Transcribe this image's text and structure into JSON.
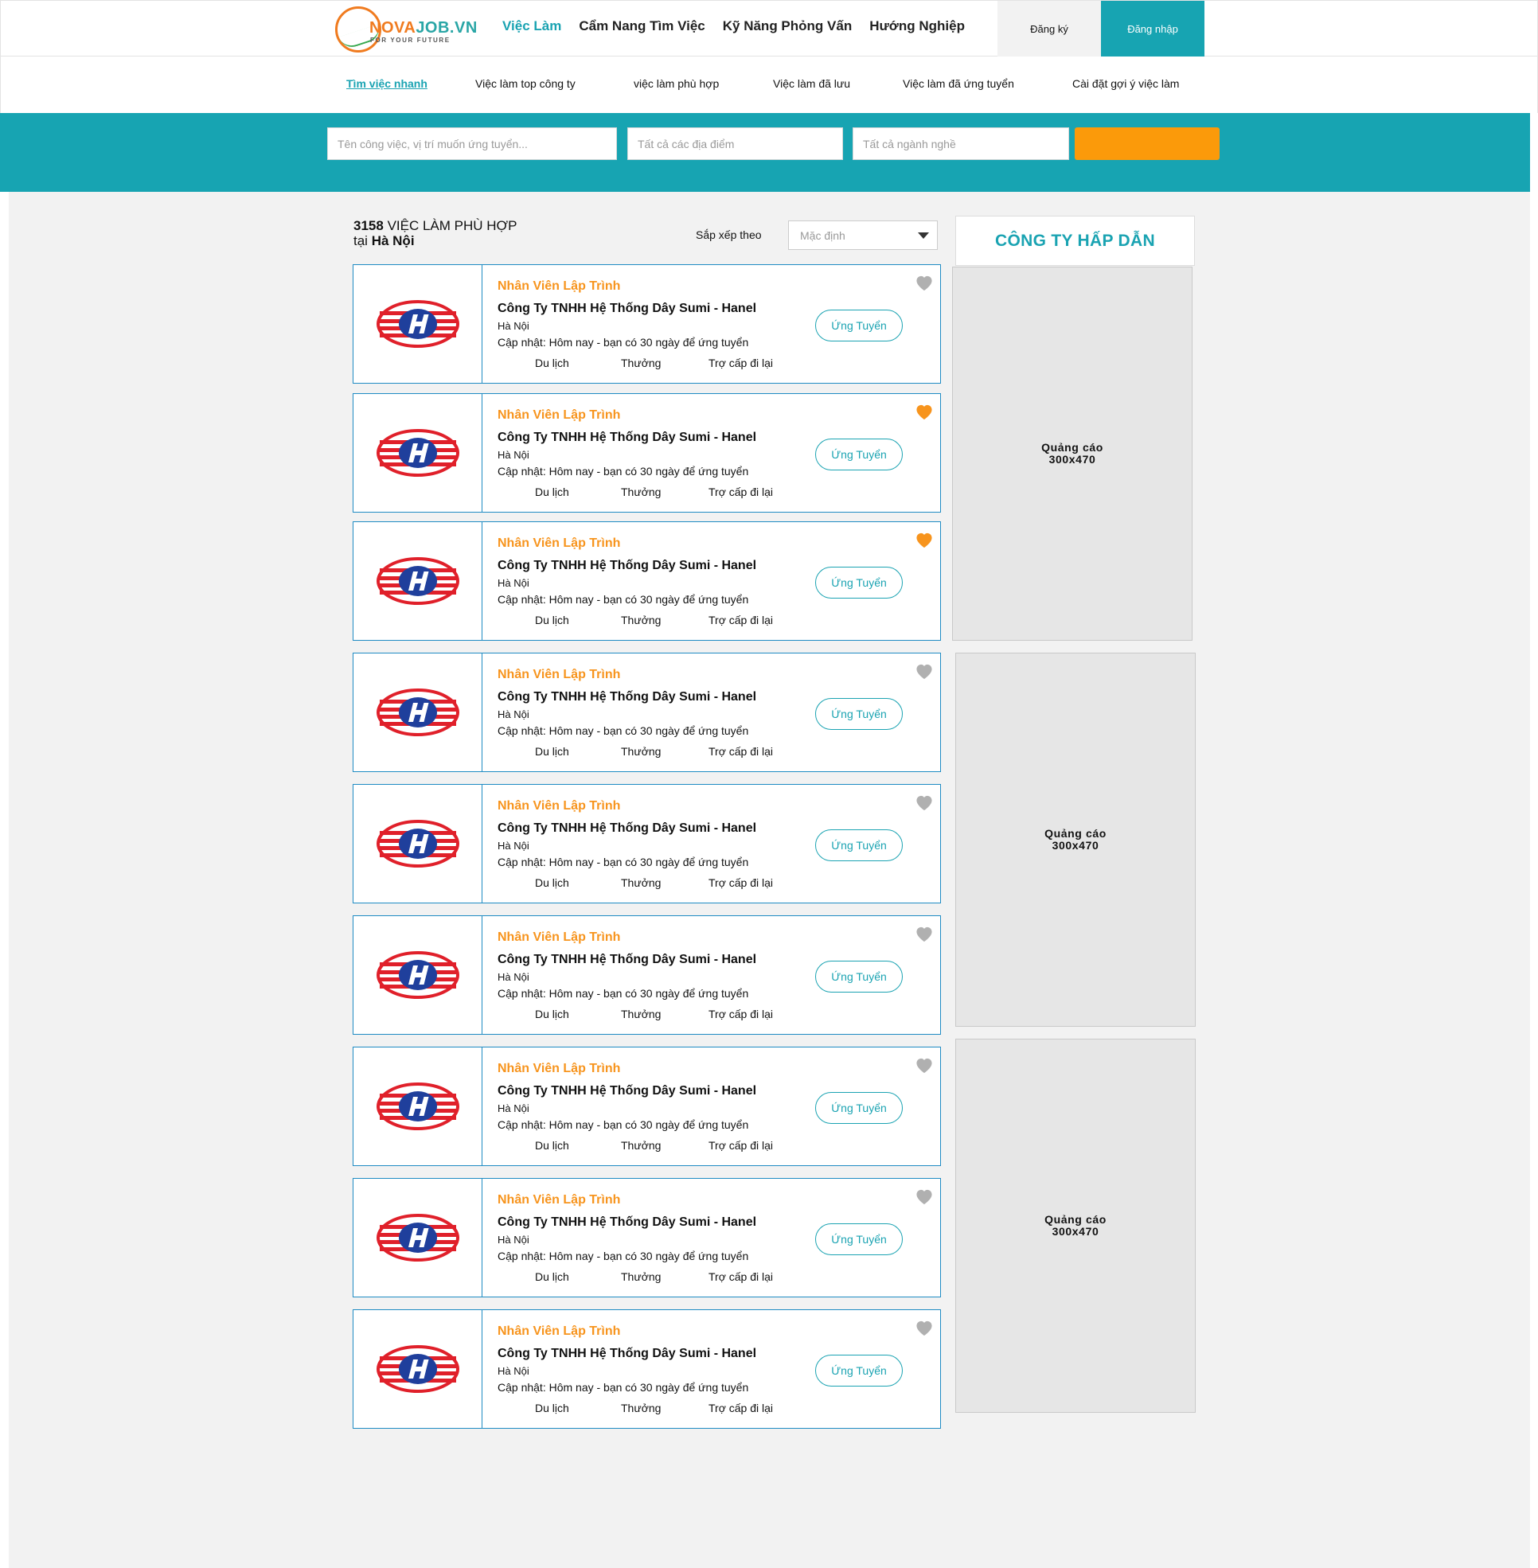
{
  "brand": {
    "part1": "NOVA",
    "part2": "JOB.VN",
    "tagline": "FOR YOUR FUTURE"
  },
  "main_nav": [
    "Việc Làm",
    "Cẩm Nang Tìm Việc",
    "Kỹ Năng Phỏng Vấn",
    "Hướng Nghiệp"
  ],
  "auth": {
    "register": "Đăng ký",
    "login": "Đăng nhập"
  },
  "sub_nav": [
    "Tìm việc nhanh",
    "Việc làm top công ty",
    "việc làm phù hợp",
    "Việc làm đã lưu",
    "Việc làm đã ứng tuyển",
    "Cài đặt gợi ý việc làm"
  ],
  "search": {
    "keyword_placeholder": "Tên công việc, vị trí muốn ứng tuyển...",
    "location_placeholder": "Tất cả các địa điểm",
    "industry_placeholder": "Tất cả ngành nghề"
  },
  "results": {
    "count": "3158",
    "label": "VIỆC LÀM PHÙ HỢP",
    "in": "tại",
    "city": "Hà Nội"
  },
  "sort": {
    "label": "Sắp xếp theo",
    "value": "Mặc định"
  },
  "jobs": [
    {
      "title": "Nhân Viên Lập Trình",
      "company": "Công Ty TNHH Hệ Thống Dây Sumi - Hanel",
      "location": "Hà Nội",
      "update": "Cập nhật: Hôm nay - bạn có 30 ngày để ứng tuyển",
      "benefits": [
        "Du lịch",
        "Thưởng",
        "Trợ cấp đi lại"
      ],
      "apply": "Ứng Tuyển",
      "saved": false
    },
    {
      "title": "Nhân Viên Lập Trình",
      "company": "Công Ty TNHH Hệ Thống Dây Sumi - Hanel",
      "location": "Hà Nội",
      "update": "Cập nhật: Hôm nay - bạn có 30 ngày để ứng tuyển",
      "benefits": [
        "Du lịch",
        "Thưởng",
        "Trợ cấp đi lại"
      ],
      "apply": "Ứng Tuyển",
      "saved": true
    },
    {
      "title": "Nhân Viên Lập Trình",
      "company": "Công Ty TNHH Hệ Thống Dây Sumi - Hanel",
      "location": "Hà Nội",
      "update": "Cập nhật: Hôm nay - bạn có 30 ngày để ứng tuyển",
      "benefits": [
        "Du lịch",
        "Thưởng",
        "Trợ cấp đi lại"
      ],
      "apply": "Ứng Tuyển",
      "saved": true
    },
    {
      "title": "Nhân Viên Lập Trình",
      "company": "Công Ty TNHH Hệ Thống Dây Sumi - Hanel",
      "location": "Hà Nội",
      "update": "Cập nhật: Hôm nay - bạn có 30 ngày để ứng tuyển",
      "benefits": [
        "Du lịch",
        "Thưởng",
        "Trợ cấp đi lại"
      ],
      "apply": "Ứng Tuyển",
      "saved": false
    },
    {
      "title": "Nhân Viên Lập Trình",
      "company": "Công Ty TNHH Hệ Thống Dây Sumi - Hanel",
      "location": "Hà Nội",
      "update": "Cập nhật: Hôm nay - bạn có 30 ngày để ứng tuyển",
      "benefits": [
        "Du lịch",
        "Thưởng",
        "Trợ cấp đi lại"
      ],
      "apply": "Ứng Tuyển",
      "saved": false
    },
    {
      "title": "Nhân Viên Lập Trình",
      "company": "Công Ty TNHH Hệ Thống Dây Sumi - Hanel",
      "location": "Hà Nội",
      "update": "Cập nhật: Hôm nay - bạn có 30 ngày để ứng tuyển",
      "benefits": [
        "Du lịch",
        "Thưởng",
        "Trợ cấp đi lại"
      ],
      "apply": "Ứng Tuyển",
      "saved": false
    },
    {
      "title": "Nhân Viên Lập Trình",
      "company": "Công Ty TNHH Hệ Thống Dây Sumi - Hanel",
      "location": "Hà Nội",
      "update": "Cập nhật: Hôm nay - bạn có 30 ngày để ứng tuyển",
      "benefits": [
        "Du lịch",
        "Thưởng",
        "Trợ cấp đi lại"
      ],
      "apply": "Ứng Tuyển",
      "saved": false
    },
    {
      "title": "Nhân Viên Lập Trình",
      "company": "Công Ty TNHH Hệ Thống Dây Sumi - Hanel",
      "location": "Hà Nội",
      "update": "Cập nhật: Hôm nay - bạn có 30 ngày để ứng tuyển",
      "benefits": [
        "Du lịch",
        "Thưởng",
        "Trợ cấp đi lại"
      ],
      "apply": "Ứng Tuyển",
      "saved": false
    },
    {
      "title": "Nhân Viên Lập Trình",
      "company": "Công Ty TNHH Hệ Thống Dây Sumi - Hanel",
      "location": "Hà Nội",
      "update": "Cập nhật: Hôm nay - bạn có 30 ngày để ứng tuyển",
      "benefits": [
        "Du lịch",
        "Thưởng",
        "Trợ cấp đi lại"
      ],
      "apply": "Ứng Tuyển",
      "saved": false
    }
  ],
  "sidebar": {
    "title": "CÔNG TY HẤP DẪN",
    "ads": [
      {
        "line1": "Quảng cáo",
        "line2": "300x470"
      },
      {
        "line1": "Quảng cáo",
        "line2": "300x470"
      },
      {
        "line1": "Quảng cáo",
        "line2": "300x470"
      }
    ]
  },
  "colors": {
    "teal": "#17a4b2",
    "orange": "#f7941d",
    "search_button": "#fb9a0a",
    "heart_saved": "#f7941d",
    "heart_default": "#b0b0b0",
    "card_border": "#1e8bc3"
  }
}
